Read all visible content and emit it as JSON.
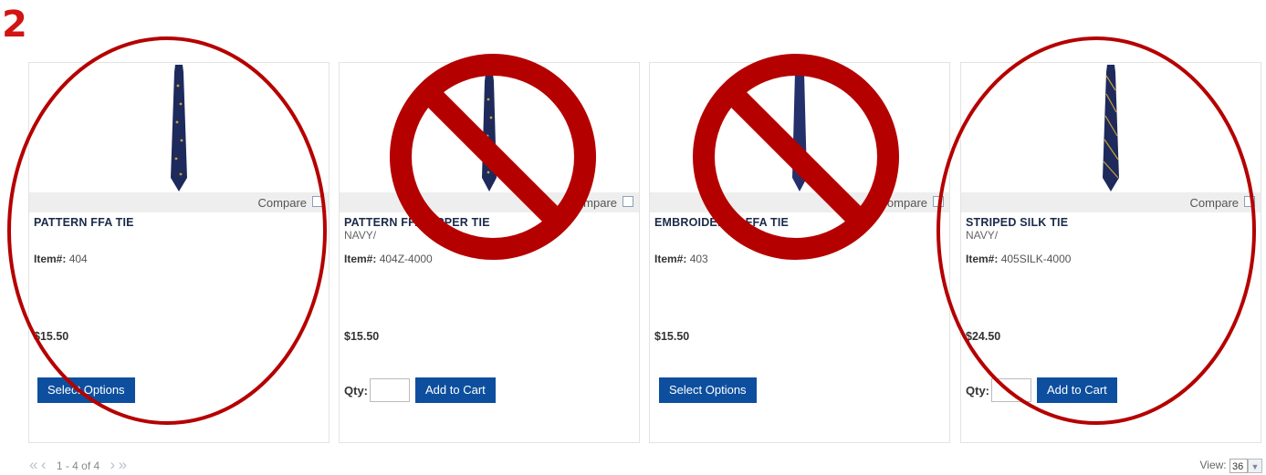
{
  "step_number": "2",
  "compare_label": "Compare",
  "item_label": "Item#:",
  "qty_label": "Qty:",
  "products": [
    {
      "title": "PATTERN FFA TIE",
      "variant": "",
      "item": "404",
      "price": "$15.50",
      "button": "Select Options",
      "marked": "circled"
    },
    {
      "title": "PATTERN FFA ZIPPER TIE",
      "variant": "NAVY/",
      "item": "404Z-4000",
      "price": "$15.50",
      "button": "Add to Cart",
      "marked": "prohibited"
    },
    {
      "title": "EMBROIDERED FFA TIE",
      "variant": "",
      "item": "403",
      "price": "$15.50",
      "button": "Select Options",
      "marked": "prohibited"
    },
    {
      "title": "STRIPED SILK TIE",
      "variant": "NAVY/",
      "item": "405SILK-4000",
      "price": "$24.50",
      "button": "Add to Cart",
      "marked": "circled"
    }
  ],
  "pager": {
    "range": "1 - 4 of 4"
  },
  "view": {
    "label": "View:",
    "value": "36"
  },
  "colors": {
    "annotation": "#b50000",
    "button": "#0d4f9e",
    "tie": "#1e2a5c",
    "title": "#1b2a4a"
  }
}
